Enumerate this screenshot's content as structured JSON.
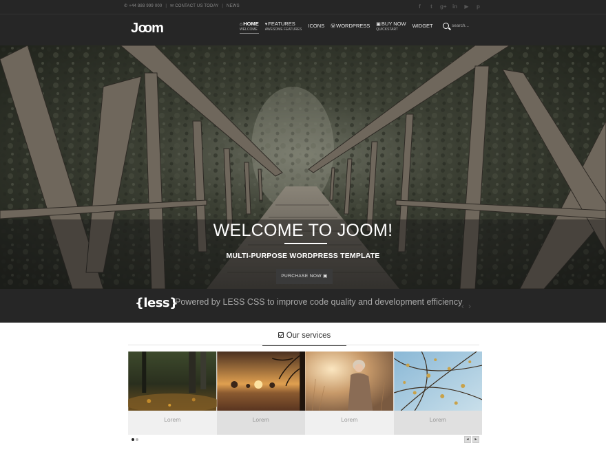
{
  "topbar": {
    "phone": "+44 888 999 000",
    "contact": "CONTACT US TODAY",
    "news": "NEWS",
    "separator": "|",
    "socials": [
      {
        "icon": "facebook-icon",
        "glyph": "f"
      },
      {
        "icon": "twitter-icon",
        "glyph": "t"
      },
      {
        "icon": "google-plus-icon",
        "glyph": "g+"
      },
      {
        "icon": "linkedin-icon",
        "glyph": "in"
      },
      {
        "icon": "youtube-icon",
        "glyph": "▶"
      },
      {
        "icon": "pinterest-icon",
        "glyph": "p"
      }
    ]
  },
  "header": {
    "logo": {
      "part1": "J",
      "part2": "oo",
      "part3": "m"
    },
    "nav": [
      {
        "label": "HOME",
        "sub": "WELCOME",
        "icon": "home-icon",
        "glyph": "⌂"
      },
      {
        "label": "FEATURES",
        "sub": "AWESOME FEATURES",
        "icon": "caret-down-icon",
        "glyph": "▾"
      },
      {
        "label": "ICONS",
        "sub": ""
      },
      {
        "label": "WORDPRESS",
        "sub": "",
        "icon": "wordpress-icon",
        "glyph": "Ⓦ"
      },
      {
        "label": "BUY NOW",
        "sub": "QUICKSTART",
        "icon": "cart-icon",
        "glyph": "🛒"
      },
      {
        "label": "WIDGET",
        "sub": ""
      }
    ],
    "search_placeholder": "search..."
  },
  "hero": {
    "title": "WELCOME TO JOOM!",
    "subtitle": "MULTI-PURPOSE WORDPRESS TEMPLATE",
    "button": "PURCHASE NOW"
  },
  "lessbar": {
    "logo": "{less}",
    "text": "Powered by LESS CSS to improve code quality and development efficiency",
    "prev": "‹",
    "next": "›"
  },
  "services": {
    "title": "Our services",
    "cards": [
      {
        "caption": "Lorem"
      },
      {
        "caption": "Lorem"
      },
      {
        "caption": "Lorem"
      },
      {
        "caption": "Lorem"
      }
    ],
    "prev": "◂",
    "next": "▸"
  }
}
